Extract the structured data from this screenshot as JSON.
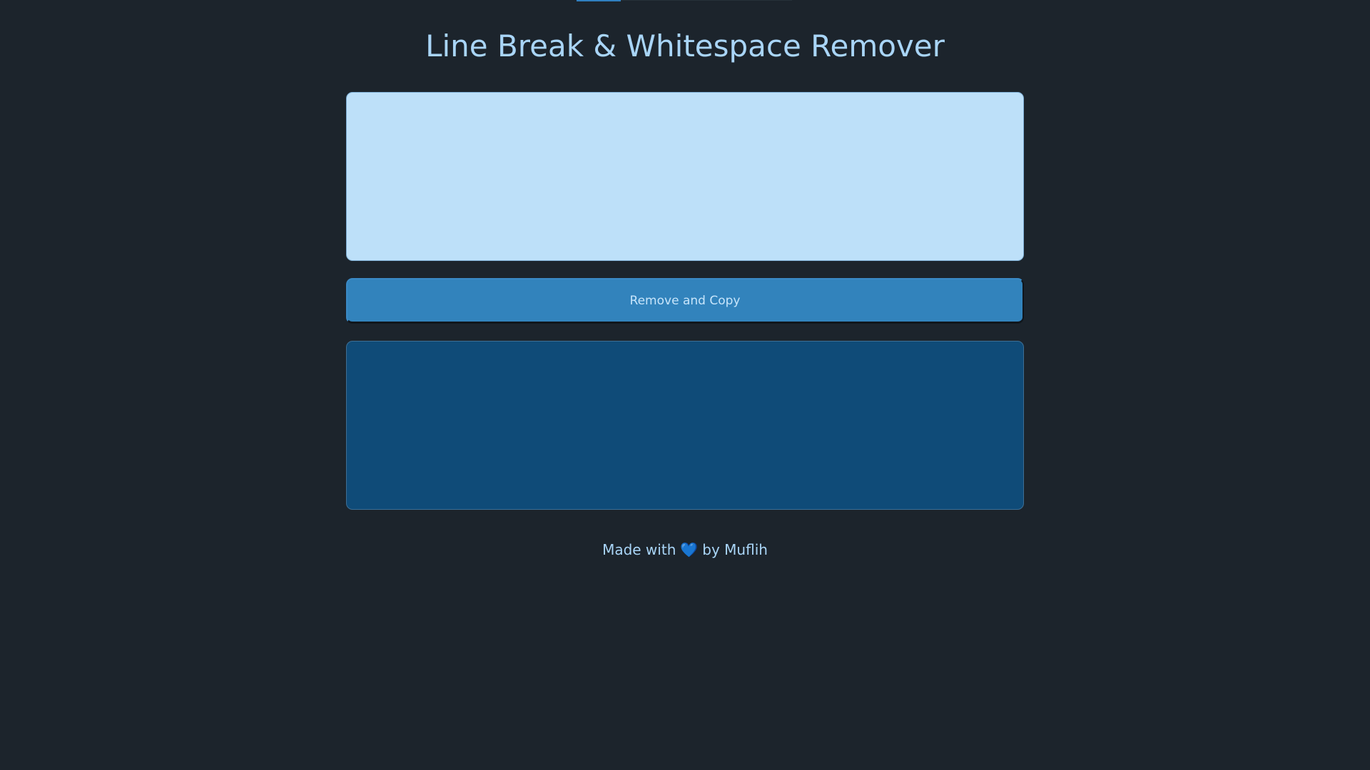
{
  "app": {
    "title": "Line Break & Whitespace Remover"
  },
  "input": {
    "value": "",
    "placeholder": ""
  },
  "actions": {
    "remove_copy_label": "Remove and Copy"
  },
  "output": {
    "value": "",
    "placeholder": ""
  },
  "footer": {
    "made_with": "Made with",
    "heart_icon": "heart-icon",
    "heart_glyph": "💙",
    "by_author": "by Muflih"
  },
  "colors": {
    "background": "#1c242c",
    "accent": "#3283bc",
    "title": "#a9d5f7",
    "input_bg": "#bde0f9",
    "output_bg": "#0f4b78"
  }
}
